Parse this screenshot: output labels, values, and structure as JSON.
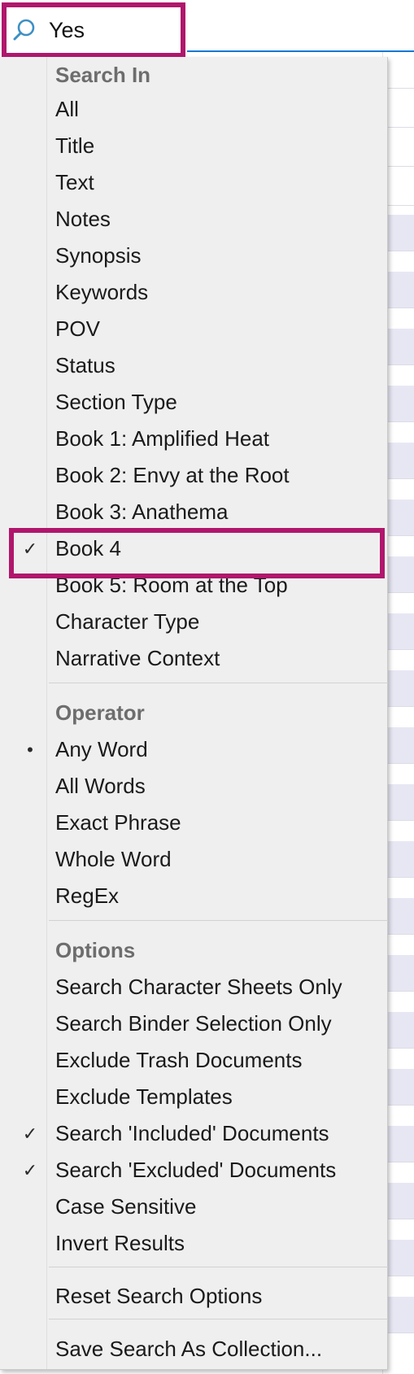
{
  "search": {
    "value": "Yes"
  },
  "menu": {
    "search_in": {
      "header": "Search In",
      "items": [
        {
          "label": "All",
          "checked": false
        },
        {
          "label": "Title",
          "checked": false
        },
        {
          "label": "Text",
          "checked": false
        },
        {
          "label": "Notes",
          "checked": false
        },
        {
          "label": "Synopsis",
          "checked": false
        },
        {
          "label": "Keywords",
          "checked": false
        },
        {
          "label": "POV",
          "checked": false
        },
        {
          "label": "Status",
          "checked": false
        },
        {
          "label": "Section Type",
          "checked": false
        },
        {
          "label": "Book 1: Amplified Heat",
          "checked": false
        },
        {
          "label": "Book 2: Envy at the Root",
          "checked": false
        },
        {
          "label": "Book 3: Anathema",
          "checked": false
        },
        {
          "label": "Book 4",
          "checked": true
        },
        {
          "label": "Book 5: Room at the Top",
          "checked": false
        },
        {
          "label": "Character Type",
          "checked": false
        },
        {
          "label": "Narrative Context",
          "checked": false
        }
      ]
    },
    "operator": {
      "header": "Operator",
      "items": [
        {
          "label": "Any Word",
          "selected": true
        },
        {
          "label": "All Words",
          "selected": false
        },
        {
          "label": "Exact Phrase",
          "selected": false
        },
        {
          "label": "Whole Word",
          "selected": false
        },
        {
          "label": "RegEx",
          "selected": false
        }
      ]
    },
    "options": {
      "header": "Options",
      "items": [
        {
          "label": "Search Character Sheets Only",
          "checked": false
        },
        {
          "label": "Search Binder Selection Only",
          "checked": false
        },
        {
          "label": "Exclude Trash Documents",
          "checked": false
        },
        {
          "label": "Exclude Templates",
          "checked": false
        },
        {
          "label": "Search 'Included' Documents",
          "checked": true
        },
        {
          "label": "Search 'Excluded' Documents",
          "checked": true
        },
        {
          "label": "Case Sensitive",
          "checked": false
        },
        {
          "label": "Invert Results",
          "checked": false
        }
      ]
    },
    "reset_label": "Reset Search Options",
    "save_label": "Save Search As Collection..."
  },
  "colors": {
    "highlight": "#b0176c",
    "menu_bg": "#efefef",
    "header_text": "#6d6d6d"
  }
}
